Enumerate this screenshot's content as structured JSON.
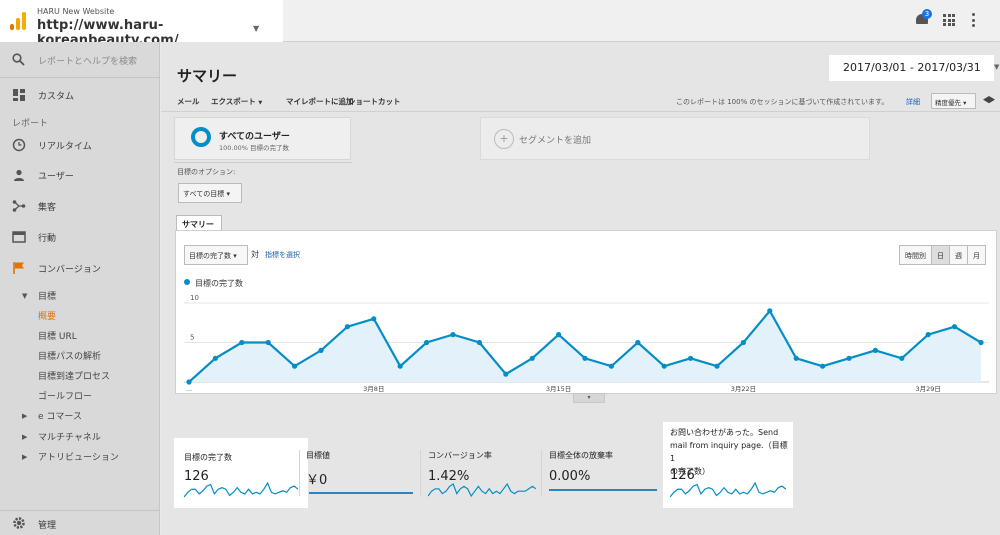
{
  "header": {
    "property_name": "HARU New Website",
    "property_url": "http://www.haru-koreanbeauty.com/",
    "notification_count": "3",
    "icons": [
      "analytics-logo",
      "notifications-icon",
      "apps-icon",
      "more-icon"
    ]
  },
  "sidebar": {
    "search_placeholder": "レポートとヘルプを検索",
    "custom": "カスタム",
    "reports_section": "レポート",
    "realtime": "リアルタイム",
    "audience": "ユーザー",
    "acquisition": "集客",
    "behavior": "行動",
    "conversions": "コンバージョン",
    "goals": "目標",
    "goals_sub": [
      "概要",
      "目標 URL",
      "目標パスの解析",
      "目標到達プロセス",
      "ゴールフロー"
    ],
    "ecommerce": "e コマース",
    "multichannel": "マルチチャネル",
    "attribution": "アトリビューション",
    "admin": "管理",
    "accent_color": "#e37400"
  },
  "page": {
    "title": "サマリー",
    "date_range": "2017/03/01 - 2017/03/31"
  },
  "toolbar": {
    "mail": "メール",
    "export": "エクスポート",
    "add_dashboard": "マイレポートに追加",
    "shortcut": "ショートカット",
    "sampling_note": "このレポートは 100% のセッションに基づいて作成されています。",
    "details_link": "詳細",
    "precision_select": "精度優先"
  },
  "segments": {
    "all_users": "すべてのユーザー",
    "all_users_pct": "100.00% 目標の完了数",
    "add_segment": "セグメントを追加"
  },
  "goal_option": {
    "label": "目標のオプション:",
    "value": "すべての目標"
  },
  "summary_tab": "サマリー",
  "chart_controls": {
    "metric": "目標の完了数",
    "vs": "対",
    "choose_metric": "指標を選択",
    "granularity": [
      "時間別",
      "日",
      "週",
      "月"
    ],
    "active_granularity": "日",
    "legend": "目標の完了数",
    "series_color": "#058dc7"
  },
  "chart_data": {
    "type": "area",
    "series": [
      {
        "name": "目標の完了数",
        "values": [
          0,
          3,
          5,
          5,
          2,
          4,
          7,
          8,
          2,
          5,
          6,
          5,
          1,
          3,
          6,
          3,
          2,
          5,
          2,
          3,
          2,
          5,
          9,
          3,
          2,
          3,
          4,
          3,
          6,
          7,
          5
        ]
      }
    ],
    "x": [
      "3/1",
      "3/2",
      "3/3",
      "3/4",
      "3/5",
      "3/6",
      "3/7",
      "3/8",
      "3/9",
      "3/10",
      "3/11",
      "3/12",
      "3/13",
      "3/14",
      "3/15",
      "3/16",
      "3/17",
      "3/18",
      "3/19",
      "3/20",
      "3/21",
      "3/22",
      "3/23",
      "3/24",
      "3/25",
      "3/26",
      "3/27",
      "3/28",
      "3/29",
      "3/30",
      "3/31"
    ],
    "x_tick_labels": [
      {
        "label": "...",
        "index": 0
      },
      {
        "label": "3月8日",
        "index": 7
      },
      {
        "label": "3月15日",
        "index": 14
      },
      {
        "label": "3月22日",
        "index": 21
      },
      {
        "label": "3月29日",
        "index": 28
      }
    ],
    "y_ticks": [
      {
        "label": "10",
        "value": 10
      },
      {
        "label": "5",
        "value": 5
      }
    ],
    "ylim": [
      0,
      10
    ],
    "title": "",
    "xlabel": "",
    "ylabel": ""
  },
  "scorecards": [
    {
      "label": "目標の完了数",
      "value": "126",
      "sparkline": [
        0,
        3,
        5,
        5,
        2,
        4,
        7,
        8,
        2,
        5,
        6,
        5,
        1,
        3,
        6,
        3,
        2,
        5,
        2,
        3,
        2,
        5,
        9,
        3,
        2,
        3,
        4,
        3,
        6,
        7,
        5
      ]
    },
    {
      "label": "目標値",
      "value": "￥0",
      "sparkline": []
    },
    {
      "label": "コンバージョン率",
      "value": "1.42%",
      "sparkline": [
        1,
        3,
        4,
        4,
        2,
        3,
        5,
        6,
        2,
        4,
        5,
        4,
        1,
        3,
        5,
        3,
        2,
        4,
        2,
        3,
        2,
        4,
        6,
        3,
        2,
        3,
        3,
        3,
        4,
        5,
        4
      ]
    },
    {
      "label": "目標全体の放棄率",
      "value": "0.00%",
      "sparkline": []
    },
    {
      "label": "お問い合わせがあった。Send mail from inquiry page.（目標 1 の完了数）",
      "label_lines": [
        "お問い合わせがあった。Send",
        "mail from inquiry page.（目標 1",
        "の完了数）"
      ],
      "value": "126",
      "sparkline": [
        0,
        3,
        5,
        5,
        2,
        4,
        7,
        8,
        2,
        5,
        6,
        5,
        1,
        3,
        6,
        3,
        2,
        5,
        2,
        3,
        2,
        5,
        9,
        3,
        2,
        3,
        4,
        3,
        6,
        7,
        5
      ]
    }
  ]
}
